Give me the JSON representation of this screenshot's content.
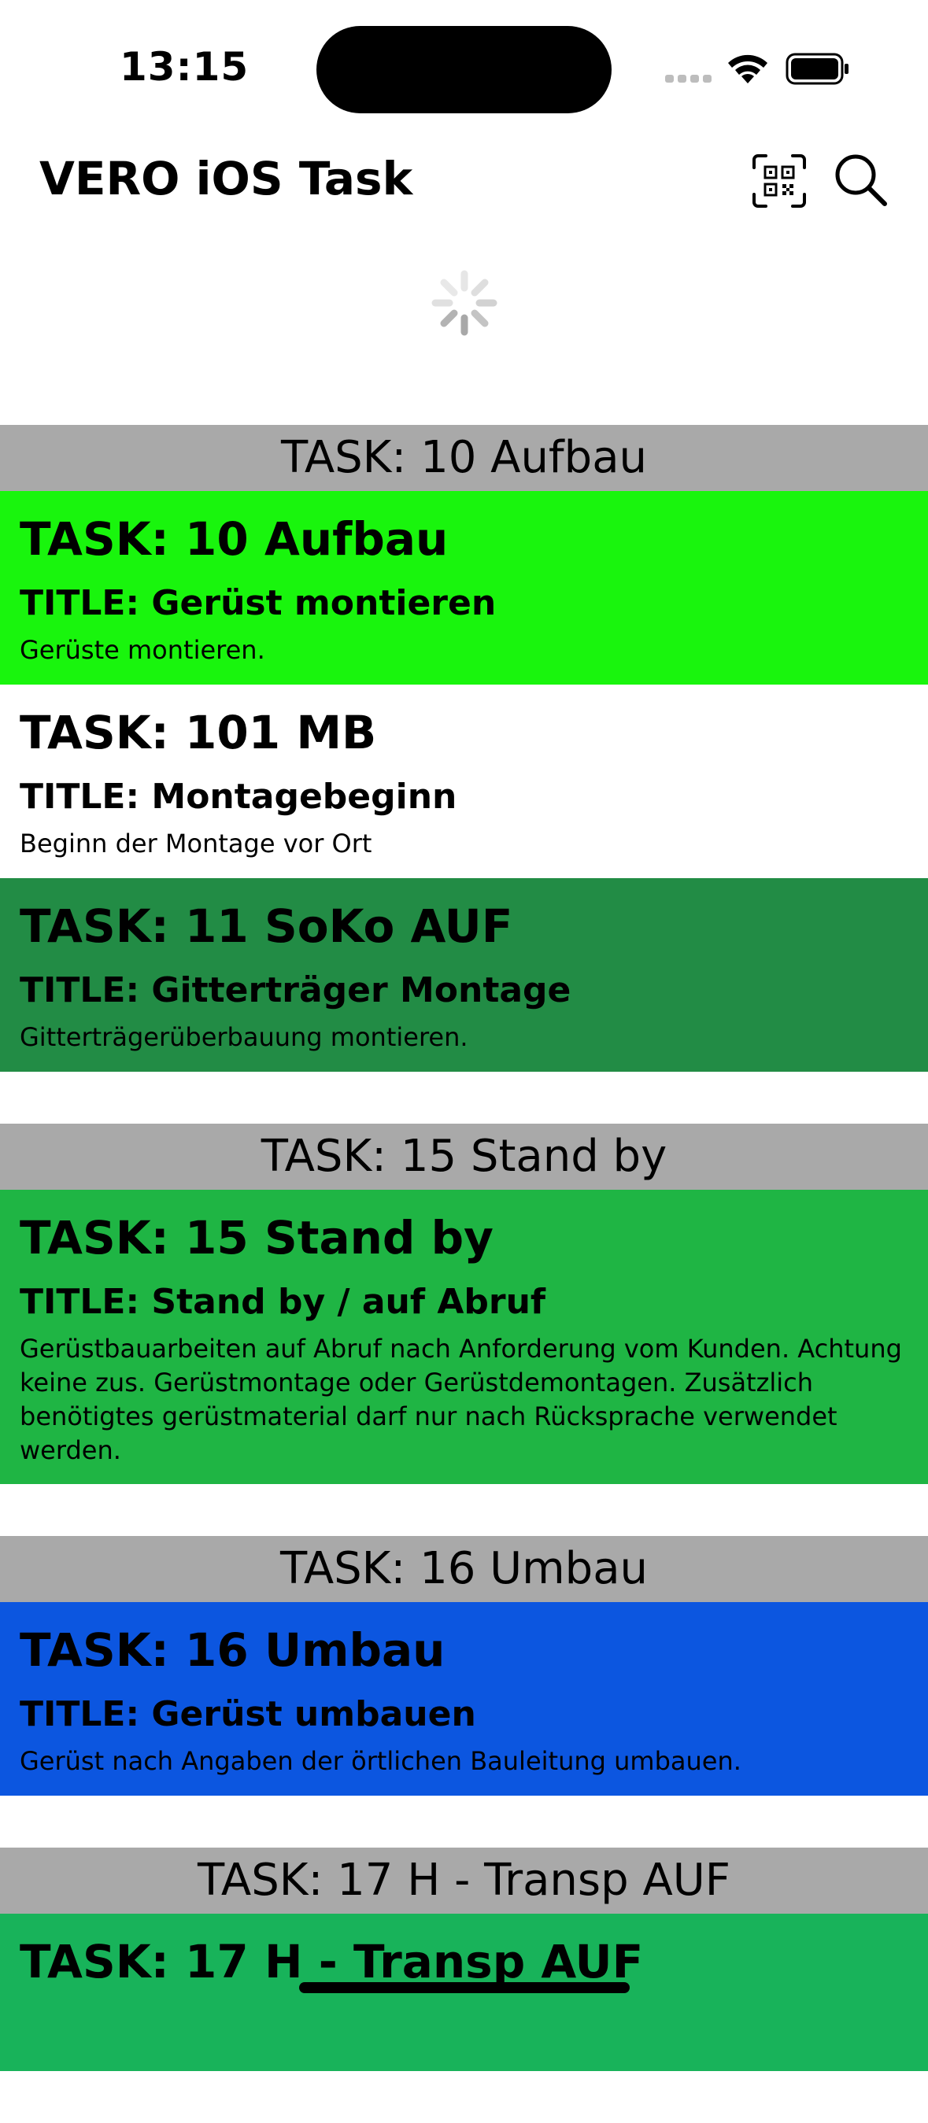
{
  "status_bar": {
    "time": "13:15"
  },
  "nav": {
    "title": "VERO iOS Task",
    "qr_icon": "qr-code-scan-icon",
    "search_icon": "magnifying-glass-icon"
  },
  "colors": {
    "header_gray": "#a9a9a9",
    "green_bright": "#19f50d",
    "white": "#ffffff",
    "green_dark": "#228c45",
    "green_mid": "#1fb544",
    "blue": "#0c56e0",
    "green_teal": "#18b35a"
  },
  "sections": [
    {
      "header": "TASK: 10 Aufbau",
      "rows": [
        {
          "task": "TASK: 10 Aufbau",
          "title": "TITLE: Gerüst montieren",
          "description": "Gerüste montieren.",
          "color": "#19f50d"
        },
        {
          "task": "TASK: 101 MB",
          "title": "TITLE: Montagebeginn",
          "description": "Beginn der Montage vor Ort",
          "color": "#ffffff"
        },
        {
          "task": "TASK: 11 SoKo AUF",
          "title": "TITLE: Gitterträger Montage",
          "description": "Gitterträgerüberbauung montieren.",
          "color": "#228c45"
        }
      ]
    },
    {
      "header": "TASK: 15 Stand by",
      "rows": [
        {
          "task": "TASK: 15 Stand by",
          "title": "TITLE: Stand by / auf Abruf",
          "description": "Gerüstbauarbeiten auf Abruf nach Anforderung vom Kunden. Achtung keine zus. Gerüstmontage oder Gerüstdemontagen. Zusätzlich benötigtes gerüstmaterial darf nur nach Rücksprache verwendet werden.",
          "color": "#1fb544"
        }
      ]
    },
    {
      "header": "TASK: 16 Umbau",
      "rows": [
        {
          "task": "TASK: 16 Umbau",
          "title": "TITLE: Gerüst umbauen",
          "description": "Gerüst nach Angaben der örtlichen Bauleitung umbauen.",
          "color": "#0c56e0"
        }
      ]
    },
    {
      "header": "TASK: 17 H - Transp AUF",
      "rows": [
        {
          "task": "TASK: 17 H - Transp AUF",
          "title": "",
          "description": "",
          "color": "#18b35a"
        }
      ]
    }
  ]
}
